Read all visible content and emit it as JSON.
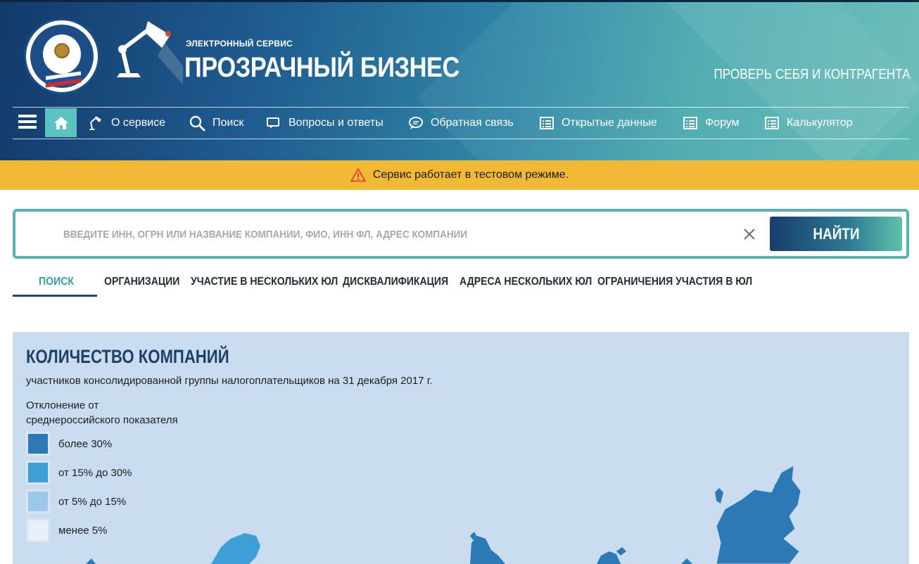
{
  "header": {
    "brand_small": "ЭЛЕКТРОННЫЙ СЕРВИС",
    "brand_big": "ПРОЗРАЧНЫЙ БИЗНЕС",
    "tagline": "ПРОВЕРЬ СЕБЯ И КОНТРАГЕНТА",
    "emblem_icon": "fns-emblem-icon",
    "lamp_icon": "desk-lamp-icon"
  },
  "nav": {
    "items": [
      {
        "label": "О сервисе",
        "icon": "lamp-icon"
      },
      {
        "label": "Поиск",
        "icon": "search-icon"
      },
      {
        "label": "Вопросы и ответы",
        "icon": "chat-icon"
      },
      {
        "label": "Обратная связь",
        "icon": "speech-bubble-icon"
      },
      {
        "label": "Открытые данные",
        "icon": "list-icon"
      },
      {
        "label": "Форум",
        "icon": "list-icon"
      },
      {
        "label": "Калькулятор",
        "icon": "list-icon"
      }
    ]
  },
  "notice": {
    "text": "Сервис работает в тестовом режиме."
  },
  "search": {
    "placeholder": "ВВЕДИТЕ ИНН, ОГРН ИЛИ НАЗВАНИЕ КОМПАНИИ, ФИО, ИНН ФЛ, АДРЕС КОМПАНИИ",
    "value": "",
    "button_label": "НАЙТИ"
  },
  "tabs": [
    {
      "label": "ПОИСК",
      "active": true
    },
    {
      "label": "ОРГАНИЗАЦИИ",
      "active": false
    },
    {
      "label": "УЧАСТИЕ В НЕСКОЛЬКИХ ЮЛ",
      "active": false
    },
    {
      "label": "ДИСКВАЛИФИКАЦИЯ",
      "active": false
    },
    {
      "label": "АДРЕСА НЕСКОЛЬКИХ ЮЛ",
      "active": false
    },
    {
      "label": "ОГРАНИЧЕНИЯ УЧАСТИЯ В ЮЛ",
      "active": false
    }
  ],
  "stats": {
    "title": "КОЛИЧЕСТВО КОМПАНИЙ",
    "subtitle": "участников консолидированной группы налогоплательщиков на 31 декабря 2017 г.",
    "legend_title_line1": "Отклонение от",
    "legend_title_line2": "среднероссийского показателя",
    "legend": [
      {
        "label": "более 30%",
        "color": "#2d79b5"
      },
      {
        "label": "от 15% до 30%",
        "color": "#3e9fd6"
      },
      {
        "label": "от 5% до 15%",
        "color": "#9cc8ea"
      },
      {
        "label": "менее 5%",
        "color": "#e8f1fa"
      }
    ]
  },
  "colors": {
    "header_dark": "#123a6b",
    "header_teal": "#62b9b5",
    "accent_teal": "#59b3b5",
    "notice_yellow": "#f2b937",
    "panel_bg": "#c9dcf0"
  }
}
